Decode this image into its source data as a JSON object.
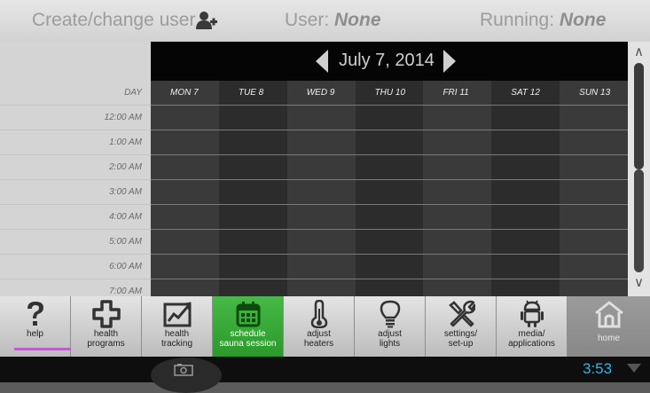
{
  "header": {
    "create_label": "Create/change user",
    "user_label": "User: ",
    "user_value": "None",
    "running_label": "Running: ",
    "running_value": "None"
  },
  "calendar": {
    "month_title": "July 7, 2014",
    "day_header_label": "DAY",
    "days": [
      "MON 7",
      "TUE 8",
      "WED 9",
      "THU 10",
      "FRI 11",
      "SAT 12",
      "SUN 13"
    ],
    "times": [
      "12:00 AM",
      "1:00 AM",
      "2:00 AM",
      "3:00 AM",
      "4:00 AM",
      "5:00 AM",
      "6:00 AM",
      "7:00 AM"
    ]
  },
  "scrollbar": {
    "up_glyph": "∧",
    "down_glyph": "∨"
  },
  "nav": {
    "items": [
      {
        "label": "help",
        "icon": "help-icon"
      },
      {
        "label": "health\nprograms",
        "icon": "health-cross-icon"
      },
      {
        "label": "health\ntracking",
        "icon": "chart-icon"
      },
      {
        "label": "schedule\nsauna session",
        "icon": "calendar-icon",
        "active": true
      },
      {
        "label": "adjust\nheaters",
        "icon": "thermometer-icon"
      },
      {
        "label": "adjust\nlights",
        "icon": "lightbulb-icon"
      },
      {
        "label": "settings/\nset-up",
        "icon": "tools-icon"
      },
      {
        "label": "media/\napplications",
        "icon": "android-icon"
      },
      {
        "label": "home",
        "icon": "home-icon"
      }
    ]
  },
  "system": {
    "clock": "3:53"
  },
  "colors": {
    "active_green": "#3aaa3a",
    "clock_blue": "#34b5e5",
    "help_underline": "#c855d6"
  }
}
